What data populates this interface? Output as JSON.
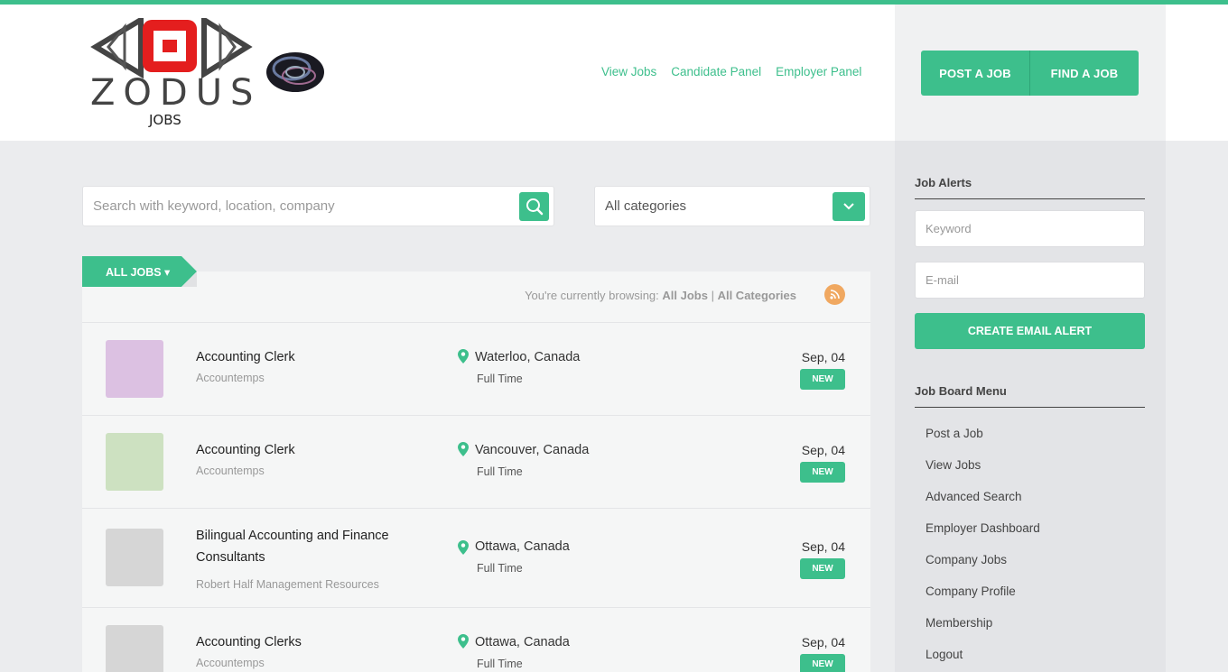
{
  "brand": {
    "name": "ZODUS",
    "sub": "JOBS"
  },
  "nav": [
    "View Jobs",
    "Candidate Panel",
    "Employer Panel"
  ],
  "header_buttons": [
    "POST A JOB",
    "FIND A JOB"
  ],
  "search": {
    "placeholder": "Search with keyword, location, company"
  },
  "category": {
    "value": "All categories"
  },
  "listing": {
    "tab_label": "ALL JOBS ▾",
    "browsing_prefix": "You're currently browsing:",
    "browsing_jobs": "All Jobs",
    "browsing_sep": " | ",
    "browsing_cat": "All Categories"
  },
  "jobs": [
    {
      "title": "Accounting Clerk",
      "company": "Accountemps",
      "location": "Waterloo, Canada",
      "type": "Full Time",
      "date": "Sep, 04",
      "badge": "NEW",
      "logo_color": "#dcc1e2"
    },
    {
      "title": "Accounting Clerk",
      "company": "Accountemps",
      "location": "Vancouver, Canada",
      "type": "Full Time",
      "date": "Sep, 04",
      "badge": "NEW",
      "logo_color": "#cde1c1"
    },
    {
      "title": "Bilingual Accounting and Finance Consultants",
      "company": "Robert Half Management Resources",
      "location": "Ottawa, Canada",
      "type": "Full Time",
      "date": "Sep, 04",
      "badge": "NEW",
      "logo_color": "#d6d6d6"
    },
    {
      "title": "Accounting Clerks",
      "company": "Accountemps",
      "location": "Ottawa, Canada",
      "type": "Full Time",
      "date": "Sep, 04",
      "badge": "NEW",
      "logo_color": "#d6d6d6"
    }
  ],
  "sidebar": {
    "alerts_title": "Job Alerts",
    "keyword_placeholder": "Keyword",
    "email_placeholder": "E-mail",
    "alert_button": "CREATE EMAIL ALERT",
    "menu_title": "Job Board Menu",
    "menu": [
      "Post a Job",
      "View Jobs",
      "Advanced Search",
      "Employer Dashboard",
      "Company Jobs",
      "Company Profile",
      "Membership",
      "Logout"
    ]
  },
  "colors": {
    "accent": "#3dbf8c",
    "rss": "#f0a860"
  }
}
